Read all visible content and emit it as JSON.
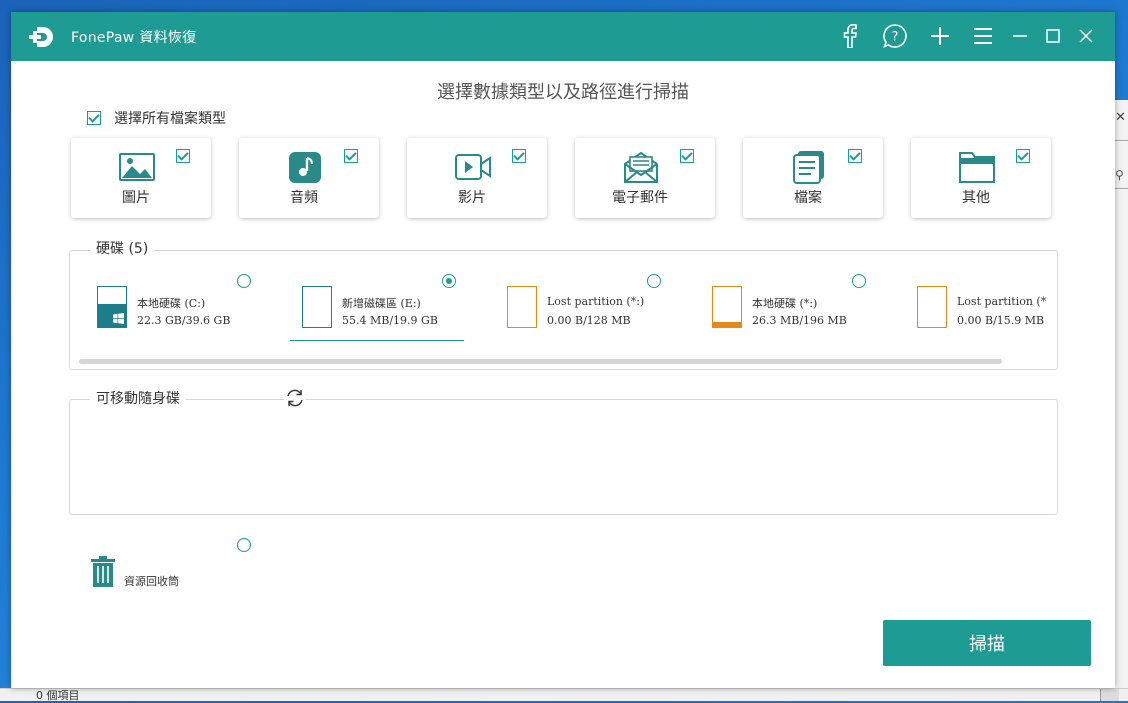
{
  "app": {
    "title": "FonePaw 資料恢復"
  },
  "titlebar": {
    "icons": [
      "facebook-icon",
      "help-icon",
      "add-icon",
      "menu-icon",
      "minimize-icon",
      "maximize-icon",
      "close-icon"
    ]
  },
  "main": {
    "heading": "選擇數據類型以及路徑進行掃描",
    "select_all_label": "選擇所有檔案類型",
    "select_all_checked": true,
    "file_types": [
      {
        "label": "圖片",
        "icon": "image-icon",
        "checked": true
      },
      {
        "label": "音頻",
        "icon": "music-icon",
        "checked": true
      },
      {
        "label": "影片",
        "icon": "video-icon",
        "checked": true
      },
      {
        "label": "電子郵件",
        "icon": "email-icon",
        "checked": true
      },
      {
        "label": "檔案",
        "icon": "document-icon",
        "checked": true
      },
      {
        "label": "其他",
        "icon": "folder-icon",
        "checked": true
      }
    ]
  },
  "disks": {
    "legend": "硬碟 (5)",
    "selected_index": 1,
    "items": [
      {
        "name": "本地硬碟 (C:)",
        "size": "22.3 GB/39.6 GB",
        "used": 0.563,
        "kind": "system",
        "color": "#1e7d8a"
      },
      {
        "name": "新增磁碟區 (E:)",
        "size": "55.4 MB/19.9 GB",
        "used": 0.003,
        "kind": "normal",
        "color": "#1e7d8a"
      },
      {
        "name": "Lost partition (*:)",
        "size": "0.00  B/128 MB",
        "used": 0.0,
        "kind": "lost",
        "color": "#e38a1c"
      },
      {
        "name": "本地硬碟 (*:)",
        "size": "26.3 MB/196 MB",
        "used": 0.134,
        "kind": "lost",
        "color": "#e38a1c"
      },
      {
        "name": "Lost partition (*:)",
        "size": "0.00  B/15.9 MB",
        "used": 0.0,
        "kind": "lost",
        "color": "#e38a1c"
      }
    ]
  },
  "removable": {
    "legend": "可移動隨身碟"
  },
  "recycle": {
    "label": "資源回收筒"
  },
  "scan_button": {
    "label": "掃描"
  },
  "colors": {
    "accent": "#1e9c93",
    "drive_border": "#1e7d8a",
    "lost_drive": "#e38a1c"
  },
  "taskbar": {
    "text": "0 個項目"
  }
}
